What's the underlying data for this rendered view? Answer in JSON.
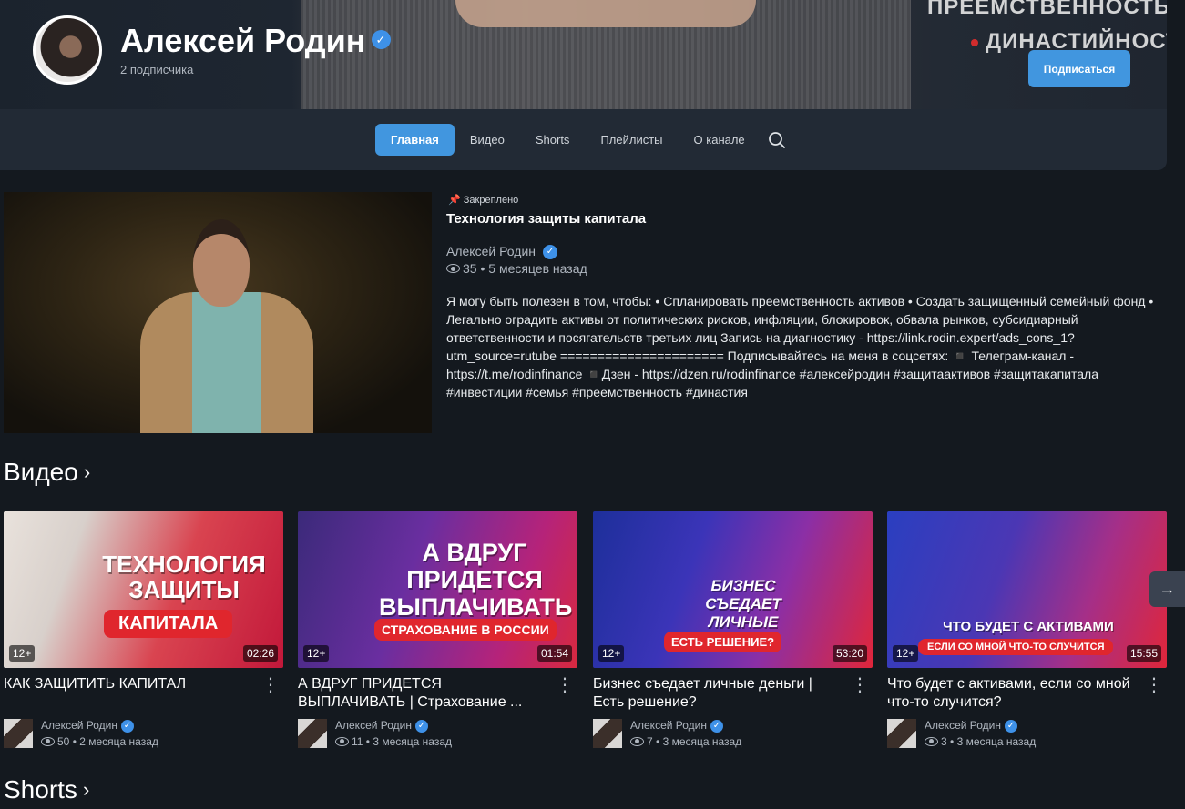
{
  "header": {
    "banner_lines": [
      "преемственность",
      "династийность"
    ],
    "channel_name": "Алексей Родин",
    "subscribers": "2 подписчика",
    "subscribe_label": "Подписаться"
  },
  "tabs": [
    {
      "label": "Главная",
      "active": true
    },
    {
      "label": "Видео",
      "active": false
    },
    {
      "label": "Shorts",
      "active": false
    },
    {
      "label": "Плейлисты",
      "active": false
    },
    {
      "label": "О канале",
      "active": false
    }
  ],
  "pinned": {
    "label": "Закреплено",
    "title": "Технология защиты капитала",
    "author": "Алексей Родин",
    "views": "35",
    "age": "5 месяцев назад",
    "description": "Я могу быть полезен в том, чтобы: • Спланировать преемственность активов • Создать защищенный семейный фонд • Легально оградить активы от политических рисков, инфляции, блокировок, обвала рынков, субсидиарный ответственности и посягательств третьих лиц Запись на диагностику - https://link.rodin.expert/ads_cons_1?utm_source=rutube ====================== Подписывайтесь на меня в соцсетях: ◾️ Телеграм-канал - https://t.me/rodinfinance ◾️Дзен - https://dzen.ru/rodinfinance #алексейродин #защитаактивов #защитакапитала #инвестиции #семья #преемственность #династия"
  },
  "videos_section": {
    "title": "Видео",
    "items": [
      {
        "title": "КАК ЗАЩИТИТЬ КАПИТАЛ",
        "thumb_text": "Технология защиты",
        "thumb_band": "Капитала",
        "age_rating": "12+",
        "duration": "02:26",
        "author": "Алексей Родин",
        "views": "50",
        "age": "2 месяца назад"
      },
      {
        "title": "А ВДРУГ ПРИДЕТСЯ ВЫПЛАЧИВАТЬ | Страхование ...",
        "thumb_text": "А вдруг придется выплачивать",
        "thumb_band": "Страхование в России",
        "age_rating": "12+",
        "duration": "01:54",
        "author": "Алексей Родин",
        "views": "11",
        "age": "3 месяца назад"
      },
      {
        "title": "Бизнес съедает личные деньги | Есть решение?",
        "thumb_text": "Бизнес съедает личные деньги",
        "thumb_band": "Есть решение?",
        "age_rating": "12+",
        "duration": "53:20",
        "author": "Алексей Родин",
        "views": "7",
        "age": "3 месяца назад"
      },
      {
        "title": "Что будет с активами, если со мной что-то случится?",
        "thumb_text": "Что будет с активами",
        "thumb_band": "Если со мной что-то случится",
        "age_rating": "12+",
        "duration": "15:55",
        "author": "Алексей Родин",
        "views": "3",
        "age": "3 месяца назад"
      }
    ]
  },
  "shorts_section": {
    "title": "Shorts"
  },
  "colors": {
    "background": "#14191f",
    "card": "#222a35",
    "accent": "#4196df",
    "verified": "#3e91e8",
    "thumb_red": "#e0262d"
  },
  "icons": [
    "verified-icon",
    "search-icon",
    "pin-icon",
    "eye-icon",
    "chevron-right-icon",
    "more-vert-icon",
    "arrow-right-icon"
  ]
}
